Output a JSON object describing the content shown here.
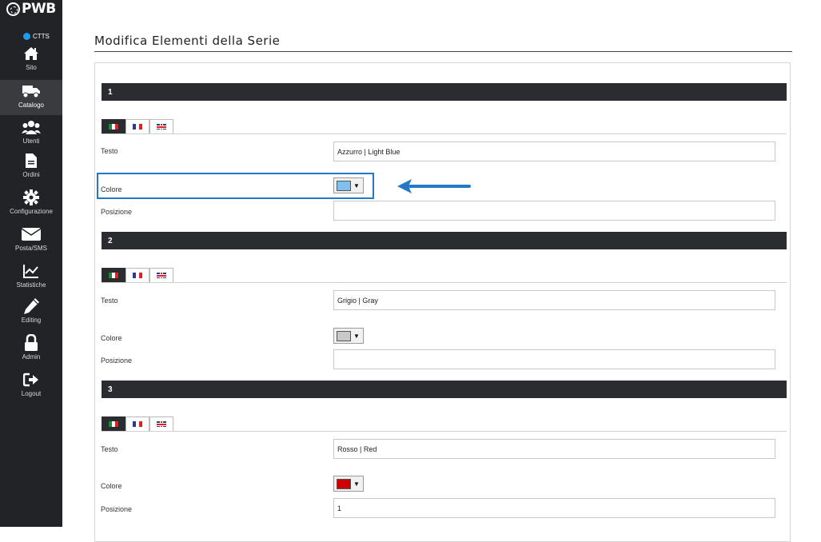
{
  "sidebar": {
    "logo_text": "PWB",
    "site_code": "CTTS",
    "items": [
      {
        "label": "Sito",
        "icon": "home-icon"
      },
      {
        "label": "Catalogo",
        "icon": "truck-icon"
      },
      {
        "label": "Utenti",
        "icon": "users-icon"
      },
      {
        "label": "Ordini",
        "icon": "file-icon"
      },
      {
        "label": "Configurazione",
        "icon": "gear-icon"
      },
      {
        "label": "Posta/SMS",
        "icon": "envelope-icon"
      },
      {
        "label": "Statistiche",
        "icon": "chart-line-icon"
      },
      {
        "label": "Editing",
        "icon": "pencil-icon"
      },
      {
        "label": "Admin",
        "icon": "lock-icon"
      },
      {
        "label": "Logout",
        "icon": "logout-icon"
      }
    ],
    "active_item": "Catalogo"
  },
  "main": {
    "title": "Modifica Elementi della Serie",
    "labels": {
      "text": "Testo",
      "color": "Colore",
      "position": "Posizione"
    },
    "sections": [
      {
        "number": "1",
        "text_value": "Azzurro | Light Blue",
        "color": "#7ec0ee",
        "position_value": ""
      },
      {
        "number": "2",
        "text_value": "Grigio | Gray",
        "color": "#c8c8c8",
        "position_value": ""
      },
      {
        "number": "3",
        "text_value": "Rosso | Red",
        "color": "#cc0000",
        "position_value": "1"
      }
    ],
    "language_tabs": [
      "italian-flag",
      "french-flag",
      "uk-flag"
    ]
  },
  "colors": {
    "sidebar_bg": "#222326",
    "section_bar": "#2b2c30",
    "highlight": "#2478c8",
    "status_dot": "#1e9bf0"
  }
}
